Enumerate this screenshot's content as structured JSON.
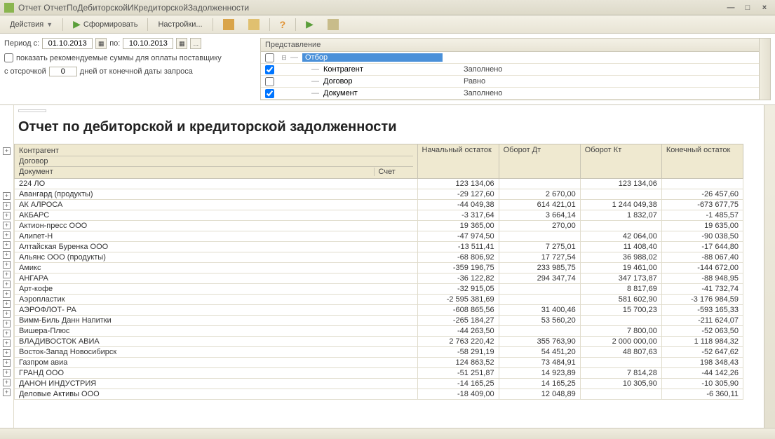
{
  "window": {
    "title": "Отчет  ОтчетПоДебиторскойИКредиторскойЗадолженности"
  },
  "toolbar": {
    "actions": "Действия",
    "generate": "Сформировать",
    "settings": "Настройки..."
  },
  "filters": {
    "period_label": "Период с:",
    "date_from": "01.10.2013",
    "to_label": "по:",
    "date_to": "10.10.2013",
    "show_recommended": "показать рекомендуемые суммы для оплаты поставщику",
    "delay_label_pre": "с отсрочкой",
    "delay_days": "0",
    "delay_label_post": "дней от конечной даты запроса"
  },
  "selection_grid": {
    "header": "Представление",
    "rows": [
      {
        "checked": false,
        "expand": true,
        "name": "Отбор",
        "cond": "",
        "highlight": true
      },
      {
        "checked": true,
        "expand": false,
        "name": "Контрагент",
        "cond": "Заполнено"
      },
      {
        "checked": false,
        "expand": false,
        "name": "Договор",
        "cond": "Равно"
      },
      {
        "checked": true,
        "expand": false,
        "name": "Документ",
        "cond": "Заполнено"
      }
    ]
  },
  "report": {
    "title": "Отчет по дебиторской и кредиторской задолженности",
    "headers": {
      "counterparty": "Контрагент",
      "contract": "Договор",
      "document": "Документ",
      "account": "Счет",
      "opening": "Начальный остаток",
      "debit": "Оборот Дт",
      "credit": "Оборот Кт",
      "closing": "Конечный остаток"
    },
    "rows": [
      {
        "name": "224 ЛО",
        "open": "123 134,06",
        "dt": "",
        "kt": "123 134,06",
        "close": ""
      },
      {
        "name": "Авангард (продукты)",
        "open": "-29 127,60",
        "dt": "2 670,00",
        "kt": "",
        "close": "-26 457,60"
      },
      {
        "name": "АК АЛРОСА",
        "open": "-44 049,38",
        "dt": "614 421,01",
        "kt": "1 244 049,38",
        "close": "-673 677,75"
      },
      {
        "name": "АКБАРС",
        "open": "-3 317,64",
        "dt": "3 664,14",
        "kt": "1 832,07",
        "close": "-1 485,57"
      },
      {
        "name": "Актион-пресс ООО",
        "open": "19 365,00",
        "dt": "270,00",
        "kt": "",
        "close": "19 635,00"
      },
      {
        "name": "Алипет-Н",
        "open": "-47 974,50",
        "dt": "",
        "kt": "42 064,00",
        "close": "-90 038,50"
      },
      {
        "name": "Алтайская Буренка ООО",
        "open": "-13 511,41",
        "dt": "7 275,01",
        "kt": "11 408,40",
        "close": "-17 644,80"
      },
      {
        "name": "Альянс ООО (продукты)",
        "open": "-68 806,92",
        "dt": "17 727,54",
        "kt": "36 988,02",
        "close": "-88 067,40"
      },
      {
        "name": "Амикс",
        "open": "-359 196,75",
        "dt": "233 985,75",
        "kt": "19 461,00",
        "close": "-144 672,00"
      },
      {
        "name": "АНГАРА",
        "open": "-36 122,82",
        "dt": "294 347,74",
        "kt": "347 173,87",
        "close": "-88 948,95"
      },
      {
        "name": "Арт-кофе",
        "open": "-32 915,05",
        "dt": "",
        "kt": "8 817,69",
        "close": "-41 732,74"
      },
      {
        "name": "Аэропластик",
        "open": "-2 595 381,69",
        "dt": "",
        "kt": "581 602,90",
        "close": "-3 176 984,59"
      },
      {
        "name": "АЭРОФЛОТ- РА",
        "open": "-608 865,56",
        "dt": "31 400,46",
        "kt": "15 700,23",
        "close": "-593 165,33"
      },
      {
        "name": "Вимм-Биль Данн Напитки",
        "open": "-265 184,27",
        "dt": "53 560,20",
        "kt": "",
        "close": "-211 624,07"
      },
      {
        "name": "Вишера-Плюс",
        "open": "-44 263,50",
        "dt": "",
        "kt": "7 800,00",
        "close": "-52 063,50"
      },
      {
        "name": "ВЛАДИВОСТОК АВИА",
        "open": "2 763 220,42",
        "dt": "355 763,90",
        "kt": "2 000 000,00",
        "close": "1 118 984,32"
      },
      {
        "name": "Восток-Запад Новосибирск",
        "open": "-58 291,19",
        "dt": "54 451,20",
        "kt": "48 807,63",
        "close": "-52 647,62"
      },
      {
        "name": "Газпром  авиа",
        "open": "124 863,52",
        "dt": "73 484,91",
        "kt": "",
        "close": "198 348,43"
      },
      {
        "name": "ГРАНД  ООО",
        "open": "-51 251,87",
        "dt": "14 923,89",
        "kt": "7 814,28",
        "close": "-44 142,26"
      },
      {
        "name": "ДАНОН ИНДУСТРИЯ",
        "open": "-14 165,25",
        "dt": "14 165,25",
        "kt": "10 305,90",
        "close": "-10 305,90"
      },
      {
        "name": "Деловые Активы ООО",
        "open": "-18 409,00",
        "dt": "12 048,89",
        "kt": "",
        "close": "-6 360,11"
      }
    ]
  }
}
